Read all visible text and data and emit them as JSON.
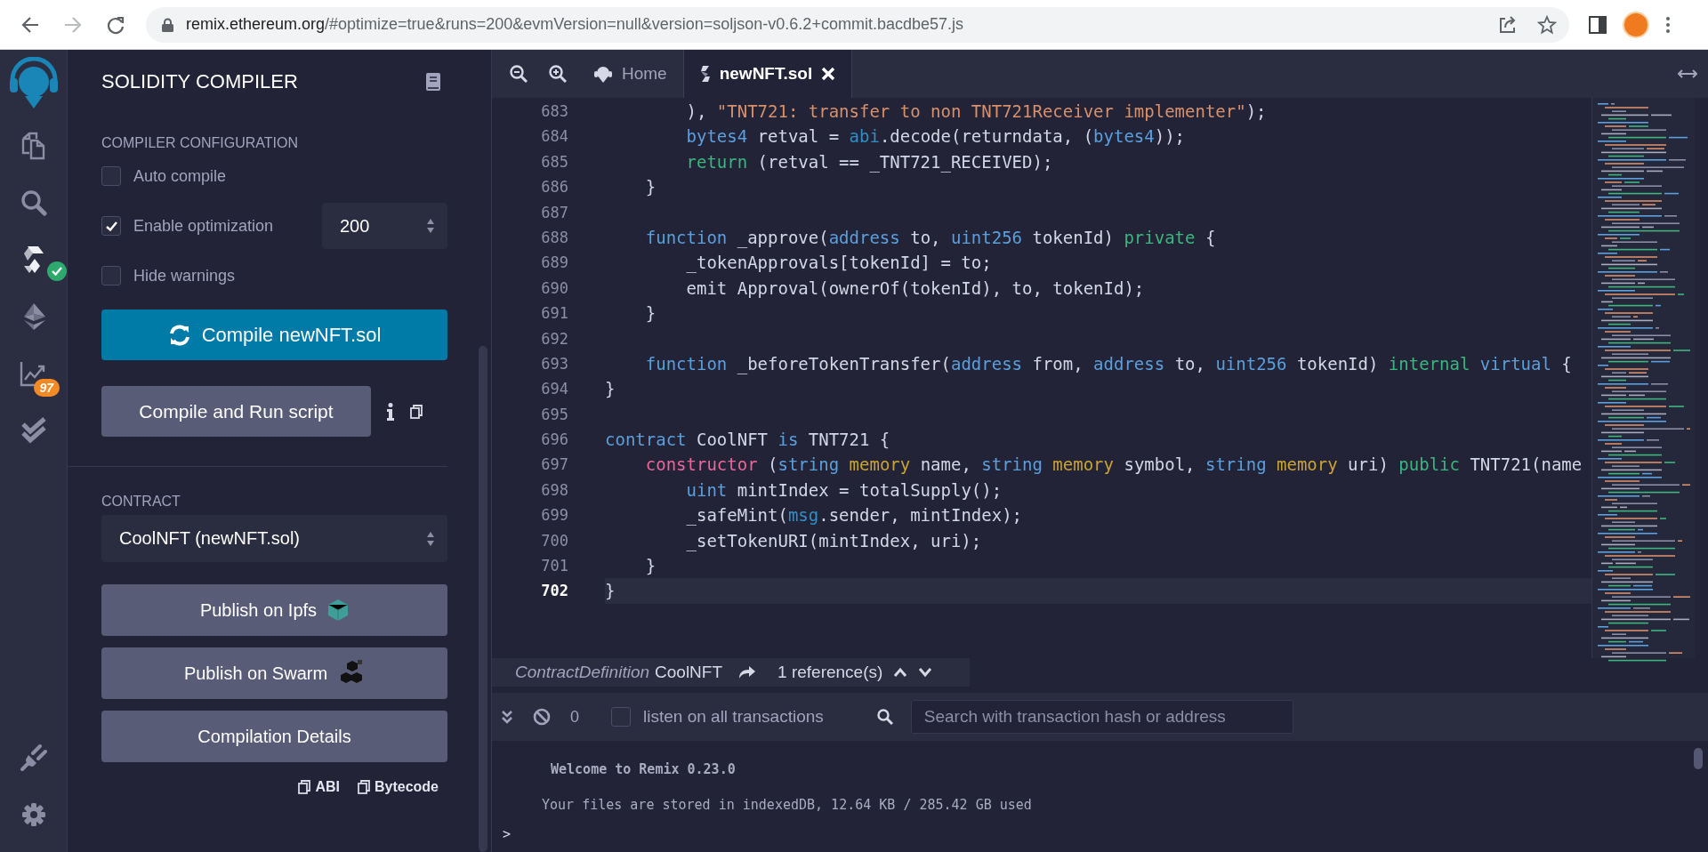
{
  "browser": {
    "url_host": "remix.ethereum.org",
    "url_path": "/#optimize=true&runs=200&evmVersion=null&version=soljson-v0.6.2+commit.bacdbe57.js",
    "forward_disabled": true
  },
  "icon_bar": [
    {
      "kind": "files",
      "selected": false
    },
    {
      "kind": "search",
      "selected": false
    },
    {
      "kind": "compiler",
      "selected": true,
      "compiled": true
    },
    {
      "kind": "deploy",
      "selected": false
    },
    {
      "kind": "analysis",
      "selected": false,
      "badge": "97"
    },
    {
      "kind": "tests",
      "selected": false
    }
  ],
  "icon_bar_bottom": [
    {
      "kind": "plugin"
    },
    {
      "kind": "settings"
    }
  ],
  "side_panel": {
    "title": "SOLIDITY COMPILER",
    "config_label": "COMPILER CONFIGURATION",
    "options": [
      {
        "label": "Auto compile",
        "checked": false
      },
      {
        "label": "Enable optimization",
        "checked": true,
        "runs": "200"
      },
      {
        "label": "Hide warnings",
        "checked": false
      }
    ],
    "compile_button": "Compile newNFT.sol",
    "run_script_button": "Compile and Run script",
    "contract_label": "CONTRACT",
    "contract_select": "CoolNFT (newNFT.sol)",
    "actions": [
      {
        "label": "Publish on Ipfs",
        "kind": "ipfs"
      },
      {
        "label": "Publish on Swarm",
        "kind": "swarm"
      },
      {
        "label": "Compilation Details",
        "kind": "plain"
      }
    ],
    "copy_links": [
      "ABI",
      "Bytecode"
    ]
  },
  "editor": {
    "tabs": [
      {
        "label": "Home",
        "kind": "home",
        "selected": false
      },
      {
        "label": "newNFT.sol",
        "kind": "file",
        "selected": true
      }
    ],
    "lines": [
      {
        "number": "683",
        "current": false,
        "tokens": [
          {
            "kind": "plain",
            "text": "        ), "
          },
          {
            "kind": "string",
            "text": "\"TNT721: transfer to non TNT721Receiver implementer\""
          },
          {
            "kind": "plain",
            "text": ");"
          }
        ]
      },
      {
        "number": "684",
        "current": false,
        "tokens": [
          {
            "kind": "type",
            "text": "        bytes4"
          },
          {
            "kind": "plain",
            "text": " retval = "
          },
          {
            "kind": "builtin",
            "text": "abi"
          },
          {
            "kind": "plain",
            "text": ".decode(returndata, ("
          },
          {
            "kind": "type",
            "text": "bytes4"
          },
          {
            "kind": "plain",
            "text": "));"
          }
        ]
      },
      {
        "number": "685",
        "current": false,
        "tokens": [
          {
            "kind": "keyword",
            "text": "        return"
          },
          {
            "kind": "plain",
            "text": " (retval == _TNT721_RECEIVED);"
          }
        ]
      },
      {
        "number": "686",
        "current": false,
        "tokens": [
          {
            "kind": "plain",
            "text": "    }"
          }
        ]
      },
      {
        "number": "687",
        "current": false
      },
      {
        "number": "688",
        "current": false,
        "tokens": [
          {
            "kind": "type",
            "text": "    function"
          },
          {
            "kind": "plain",
            "text": " _approve("
          },
          {
            "kind": "type",
            "text": "address"
          },
          {
            "kind": "plain",
            "text": " to, "
          },
          {
            "kind": "type",
            "text": "uint256"
          },
          {
            "kind": "plain",
            "text": " tokenId) "
          },
          {
            "kind": "keyword",
            "text": "private"
          },
          {
            "kind": "plain",
            "text": " {"
          }
        ]
      },
      {
        "number": "689",
        "current": false,
        "tokens": [
          {
            "kind": "plain",
            "text": "        _tokenApprovals[tokenId] = to;"
          }
        ]
      },
      {
        "number": "690",
        "current": false,
        "tokens": [
          {
            "kind": "plain",
            "text": "        emit Approval(ownerOf(tokenId), to, tokenId);"
          }
        ]
      },
      {
        "number": "691",
        "current": false,
        "tokens": [
          {
            "kind": "plain",
            "text": "    }"
          }
        ]
      },
      {
        "number": "692",
        "current": false
      },
      {
        "number": "693",
        "current": false,
        "tokens": [
          {
            "kind": "type",
            "text": "    function"
          },
          {
            "kind": "plain",
            "text": " _beforeTokenTransfer("
          },
          {
            "kind": "type",
            "text": "address"
          },
          {
            "kind": "plain",
            "text": " from, "
          },
          {
            "kind": "type",
            "text": "address"
          },
          {
            "kind": "plain",
            "text": " to, "
          },
          {
            "kind": "type",
            "text": "uint256"
          },
          {
            "kind": "plain",
            "text": " tokenId) "
          },
          {
            "kind": "keyword",
            "text": "internal "
          },
          {
            "kind": "type",
            "text": "virtual"
          },
          {
            "kind": "plain",
            "text": " {"
          }
        ]
      },
      {
        "number": "694",
        "current": false,
        "tokens": [
          {
            "kind": "plain",
            "text": "}"
          }
        ]
      },
      {
        "number": "695",
        "current": false
      },
      {
        "number": "696",
        "current": false,
        "tokens": [
          {
            "kind": "type",
            "text": "contract"
          },
          {
            "kind": "plain",
            "text": " CoolNFT "
          },
          {
            "kind": "type",
            "text": "is"
          },
          {
            "kind": "plain",
            "text": " TNT721 {"
          }
        ]
      },
      {
        "number": "697",
        "current": false,
        "tokens": [
          {
            "kind": "constructor",
            "text": "    constructor"
          },
          {
            "kind": "plain",
            "text": " ("
          },
          {
            "kind": "type",
            "text": "string "
          },
          {
            "kind": "storage",
            "text": "memory"
          },
          {
            "kind": "plain",
            "text": " name, "
          },
          {
            "kind": "type",
            "text": "string "
          },
          {
            "kind": "storage",
            "text": "memory"
          },
          {
            "kind": "plain",
            "text": " symbol, "
          },
          {
            "kind": "type",
            "text": "string "
          },
          {
            "kind": "storage",
            "text": "memory"
          },
          {
            "kind": "plain",
            "text": " uri) "
          },
          {
            "kind": "keyword",
            "text": "public"
          },
          {
            "kind": "plain",
            "text": " TNT721(name"
          }
        ]
      },
      {
        "number": "698",
        "current": false,
        "tokens": [
          {
            "kind": "type",
            "text": "        uint"
          },
          {
            "kind": "plain",
            "text": " mintIndex = totalSupply();"
          }
        ]
      },
      {
        "number": "699",
        "current": false,
        "tokens": [
          {
            "kind": "plain",
            "text": "        _safeMint("
          },
          {
            "kind": "builtin",
            "text": "msg"
          },
          {
            "kind": "plain",
            "text": ".sender, mintIndex);"
          }
        ]
      },
      {
        "number": "700",
        "current": false,
        "tokens": [
          {
            "kind": "plain",
            "text": "        _setTokenURI(mintIndex, uri);"
          }
        ]
      },
      {
        "number": "701",
        "current": false,
        "tokens": [
          {
            "kind": "plain",
            "text": "    }"
          }
        ]
      },
      {
        "number": "702",
        "current": true,
        "tokens": [
          {
            "kind": "plain",
            "text": "}"
          }
        ]
      }
    ],
    "reference_bar": {
      "node_type": "ContractDefinition",
      "node_name": "CoolNFT",
      "references": "1 reference(s)"
    }
  },
  "terminal": {
    "count": "0",
    "listen_label": "listen on all transactions",
    "listen_checked": false,
    "search_placeholder": "Search with transaction hash or address",
    "messages": [
      {
        "text": "Welcome to Remix 0.23.0",
        "kind": "bold"
      },
      {
        "text": "Your files are stored in indexedDB, 12.64 KB / 285.42 GB used",
        "kind": "plain"
      }
    ],
    "prompt": ">"
  }
}
